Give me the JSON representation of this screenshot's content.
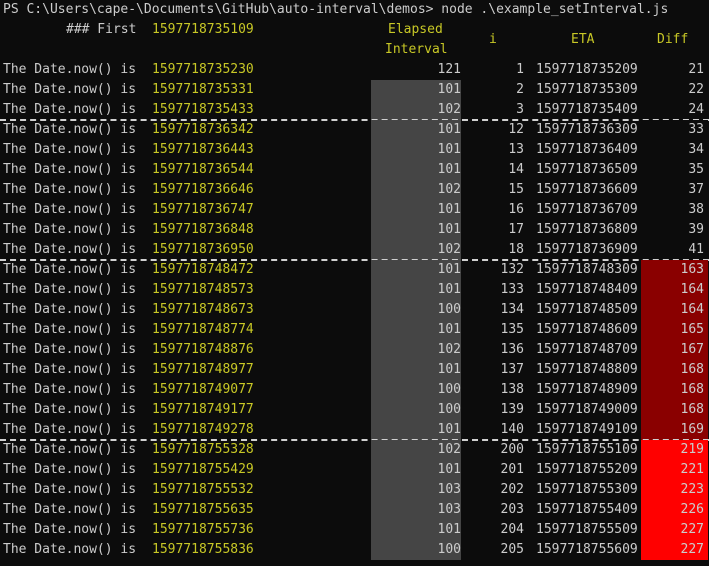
{
  "prompt": "PS C:\\Users\\cape-\\Documents\\GitHub\\auto-interval\\demos> node .\\example_setInterval.js",
  "header": {
    "first_label": "### First",
    "first_value": "1597718735109",
    "elapsed_line1": "Elapsed",
    "elapsed_line2": "Interval",
    "i": "i",
    "eta": "ETA",
    "diff": "Diff"
  },
  "row_label": "The Date.now() is",
  "colors": {
    "yellow": "#c8c826",
    "elapsed_first": "#0c0c0c",
    "elapsed_bg": "#454545",
    "diff_low": "#0c0c0c",
    "diff_mid": "#8a0000",
    "diff_high": "#ff0000"
  },
  "groups": [
    {
      "rows": [
        {
          "date": "1597718735230",
          "elapsed": "121",
          "i": "1",
          "eta": "1597718735209",
          "diff": "21"
        },
        {
          "date": "1597718735331",
          "elapsed": "101",
          "i": "2",
          "eta": "1597718735309",
          "diff": "22"
        },
        {
          "date": "1597718735433",
          "elapsed": "102",
          "i": "3",
          "eta": "1597718735409",
          "diff": "24"
        }
      ]
    },
    {
      "rows": [
        {
          "date": "1597718736342",
          "elapsed": "101",
          "i": "12",
          "eta": "1597718736309",
          "diff": "33"
        },
        {
          "date": "1597718736443",
          "elapsed": "101",
          "i": "13",
          "eta": "1597718736409",
          "diff": "34"
        },
        {
          "date": "1597718736544",
          "elapsed": "101",
          "i": "14",
          "eta": "1597718736509",
          "diff": "35"
        },
        {
          "date": "1597718736646",
          "elapsed": "102",
          "i": "15",
          "eta": "1597718736609",
          "diff": "37"
        },
        {
          "date": "1597718736747",
          "elapsed": "101",
          "i": "16",
          "eta": "1597718736709",
          "diff": "38"
        },
        {
          "date": "1597718736848",
          "elapsed": "101",
          "i": "17",
          "eta": "1597718736809",
          "diff": "39"
        },
        {
          "date": "1597718736950",
          "elapsed": "102",
          "i": "18",
          "eta": "1597718736909",
          "diff": "41"
        }
      ]
    },
    {
      "rows": [
        {
          "date": "1597718748472",
          "elapsed": "101",
          "i": "132",
          "eta": "1597718748309",
          "diff": "163"
        },
        {
          "date": "1597718748573",
          "elapsed": "101",
          "i": "133",
          "eta": "1597718748409",
          "diff": "164"
        },
        {
          "date": "1597718748673",
          "elapsed": "100",
          "i": "134",
          "eta": "1597718748509",
          "diff": "164"
        },
        {
          "date": "1597718748774",
          "elapsed": "101",
          "i": "135",
          "eta": "1597718748609",
          "diff": "165"
        },
        {
          "date": "1597718748876",
          "elapsed": "102",
          "i": "136",
          "eta": "1597718748709",
          "diff": "167"
        },
        {
          "date": "1597718748977",
          "elapsed": "101",
          "i": "137",
          "eta": "1597718748809",
          "diff": "168"
        },
        {
          "date": "1597718749077",
          "elapsed": "100",
          "i": "138",
          "eta": "1597718748909",
          "diff": "168"
        },
        {
          "date": "1597718749177",
          "elapsed": "100",
          "i": "139",
          "eta": "1597718749009",
          "diff": "168"
        },
        {
          "date": "1597718749278",
          "elapsed": "101",
          "i": "140",
          "eta": "1597718749109",
          "diff": "169"
        }
      ]
    },
    {
      "rows": [
        {
          "date": "1597718755328",
          "elapsed": "102",
          "i": "200",
          "eta": "1597718755109",
          "diff": "219"
        },
        {
          "date": "1597718755429",
          "elapsed": "101",
          "i": "201",
          "eta": "1597718755209",
          "diff": "221"
        },
        {
          "date": "1597718755532",
          "elapsed": "103",
          "i": "202",
          "eta": "1597718755309",
          "diff": "223"
        },
        {
          "date": "1597718755635",
          "elapsed": "103",
          "i": "203",
          "eta": "1597718755409",
          "diff": "226"
        },
        {
          "date": "1597718755736",
          "elapsed": "101",
          "i": "204",
          "eta": "1597718755509",
          "diff": "227"
        },
        {
          "date": "1597718755836",
          "elapsed": "100",
          "i": "205",
          "eta": "1597718755609",
          "diff": "227"
        }
      ]
    }
  ]
}
